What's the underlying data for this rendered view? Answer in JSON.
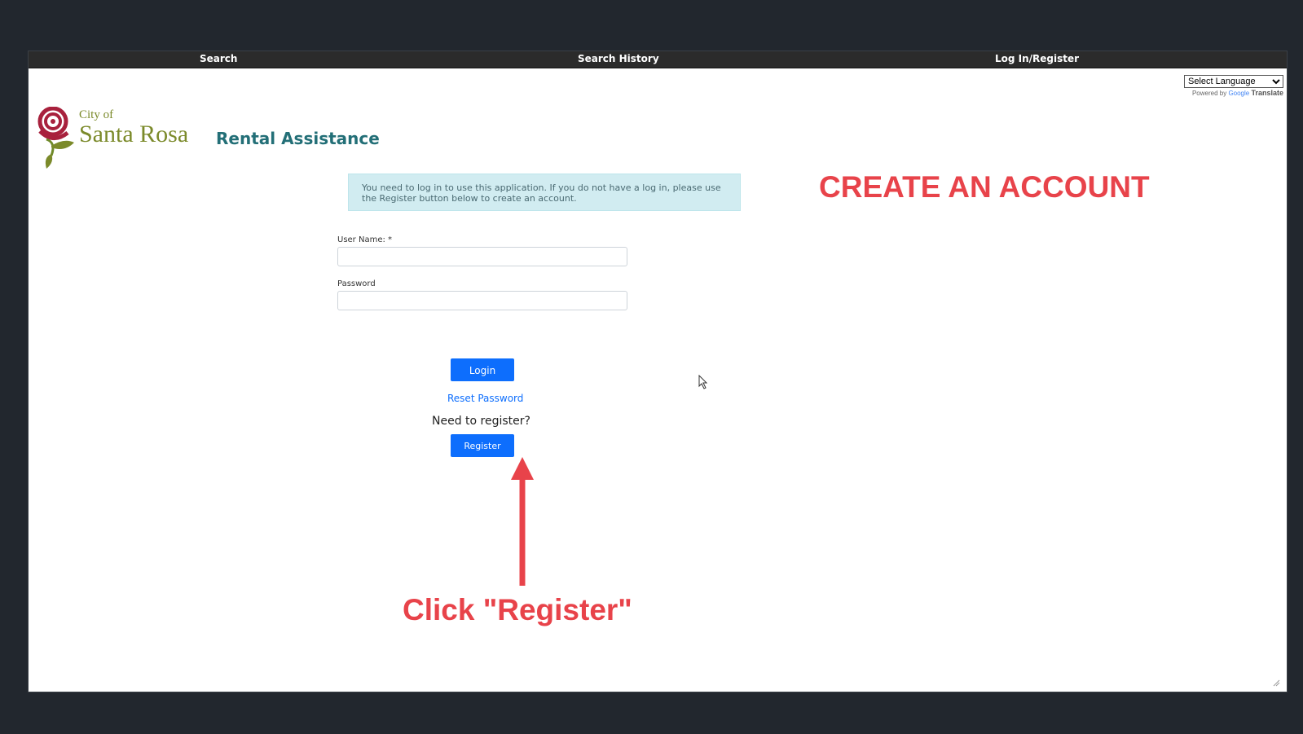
{
  "nav": {
    "search": "Search",
    "search_history": "Search History",
    "login_register": "Log In/Register"
  },
  "translate": {
    "select_label": "Select Language",
    "powered_prefix": "Powered by",
    "google": "Google",
    "translate": "Translate"
  },
  "logo": {
    "city_of": "City of",
    "name": "Santa Rosa"
  },
  "app_title": "Rental Assistance",
  "alert_text": "You need to log in to use this application. If you do not have a log in, please use the Register button below to create an account.",
  "form": {
    "username_label": "User Name: *",
    "username_value": "",
    "password_label": "Password",
    "password_value": "",
    "login_label": "Login",
    "reset_label": "Reset Password",
    "need_register": "Need to register?",
    "register_label": "Register"
  },
  "annotations": {
    "create_account": "CREATE AN ACCOUNT",
    "click_register": "Click \"Register\""
  },
  "colors": {
    "annotation": "#e8434a",
    "primary_button": "#0d6efd",
    "title": "#236f77",
    "logo": "#7b8a2a",
    "alert_bg": "#d1ecf1"
  }
}
